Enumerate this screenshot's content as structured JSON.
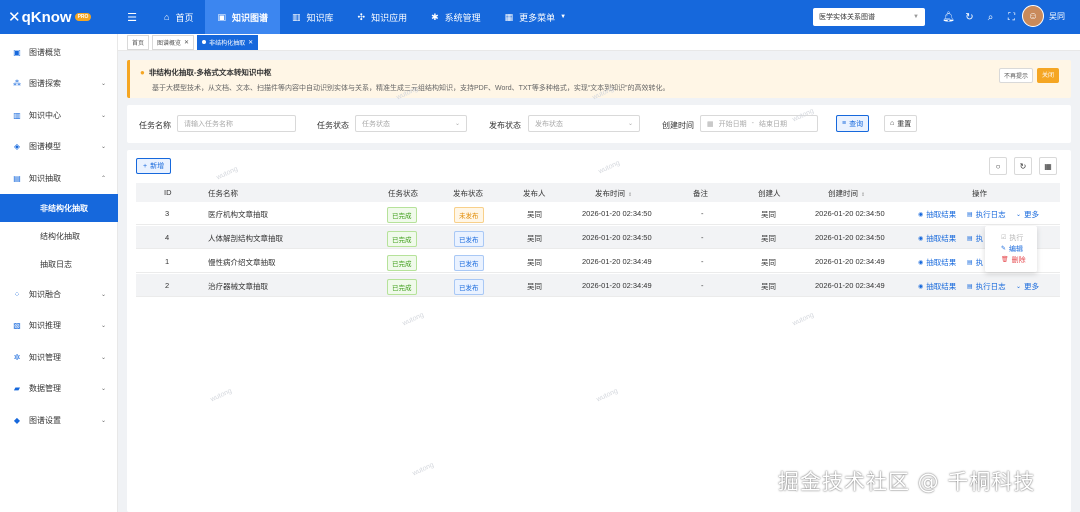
{
  "app": {
    "logo_text": "qKnow",
    "logo_badge": "PRO",
    "menu_toggle_icon": "menu-fold-icon"
  },
  "topnav": [
    {
      "label": "首页",
      "icon": "home-icon"
    },
    {
      "label": "知识图谱",
      "icon": "graph-icon",
      "active": true
    },
    {
      "label": "知识库",
      "icon": "library-icon"
    },
    {
      "label": "知识应用",
      "icon": "apps-icon"
    },
    {
      "label": "系统管理",
      "icon": "settings-icon"
    },
    {
      "label": "更多菜单",
      "icon": "grid-icon"
    }
  ],
  "graph_selector": {
    "value": "医学实体关系图谱"
  },
  "user": {
    "name": "吴同"
  },
  "sidebar": {
    "items": [
      {
        "label": "图谱概览"
      },
      {
        "label": "图谱探索"
      },
      {
        "label": "知识中心"
      },
      {
        "label": "图谱模型"
      },
      {
        "label": "知识抽取"
      },
      {
        "label": "知识融合"
      },
      {
        "label": "知识推理"
      },
      {
        "label": "知识管理"
      },
      {
        "label": "数据管理"
      },
      {
        "label": "图谱设置"
      }
    ],
    "subitems": [
      {
        "label": "非结构化抽取",
        "active": true
      },
      {
        "label": "结构化抽取"
      },
      {
        "label": "抽取日志"
      }
    ]
  },
  "tabs": [
    {
      "label": "首页"
    },
    {
      "label": "图谱概览"
    },
    {
      "label": "非结构化抽取",
      "active": true
    }
  ],
  "banner": {
    "title": "非结构化抽取-多格式文本转知识中枢",
    "description": "基于大模型技术，从文档、文本、扫描件等内容中自动识别实体与关系，精准生成三元组结构知识，支持PDF、Word、TXT等多种格式，实现“文本到知识”的高效转化。",
    "hide_label": "不再提示",
    "close_label": "关闭"
  },
  "search": {
    "task_name_label": "任务名称",
    "task_name_placeholder": "请输入任务名称",
    "task_status_label": "任务状态",
    "task_status_placeholder": "任务状态",
    "publish_status_label": "发布状态",
    "publish_status_placeholder": "发布状态",
    "created_time_label": "创建时间",
    "start_placeholder": "开始日期",
    "range_sep": "-",
    "end_placeholder": "结束日期",
    "query_label": "查询",
    "reset_label": "重置"
  },
  "table": {
    "add_label": "新增",
    "columns": [
      "ID",
      "任务名称",
      "任务状态",
      "发布状态",
      "发布人",
      "发布时间",
      "备注",
      "创建人",
      "创建时间",
      "操作"
    ],
    "rows": [
      {
        "id": "3",
        "name": "医疗机构文章抽取",
        "task_status": "已完成",
        "publish_status": "未发布",
        "publisher": "吴同",
        "publish_time": "2026-01-20 02:34:50",
        "remark": "-",
        "creator": "吴同",
        "created_time": "2026-01-20 02:34:50"
      },
      {
        "id": "4",
        "name": "人体解剖结构文章抽取",
        "task_status": "已完成",
        "publish_status": "已发布",
        "publisher": "吴同",
        "publish_time": "2026-01-20 02:34:50",
        "remark": "-",
        "creator": "吴同",
        "created_time": "2026-01-20 02:34:50"
      },
      {
        "id": "1",
        "name": "慢性病介绍文章抽取",
        "task_status": "已完成",
        "publish_status": "已发布",
        "publisher": "吴同",
        "publish_time": "2026-01-20 02:34:49",
        "remark": "-",
        "creator": "吴同",
        "created_time": "2026-01-20 02:34:49"
      },
      {
        "id": "2",
        "name": "治疗器械文章抽取",
        "task_status": "已完成",
        "publish_status": "已发布",
        "publisher": "吴同",
        "publish_time": "2026-01-20 02:34:49",
        "remark": "-",
        "creator": "吴同",
        "created_time": "2026-01-20 02:34:49"
      }
    ],
    "ops": {
      "result": "抽取结果",
      "log": "执行日志",
      "log_truncated": "执",
      "more": "更多"
    }
  },
  "more_menu": {
    "execute": "执行",
    "edit": "编辑",
    "delete": "删除"
  },
  "watermark": {
    "text": "wutong"
  },
  "footer_watermark": "掘金技术社区 @ 千桐科技",
  "colors": {
    "primary": "#1668dc",
    "warning": "#f5a623",
    "success": "#3e9e1a",
    "danger": "#e5484d"
  }
}
